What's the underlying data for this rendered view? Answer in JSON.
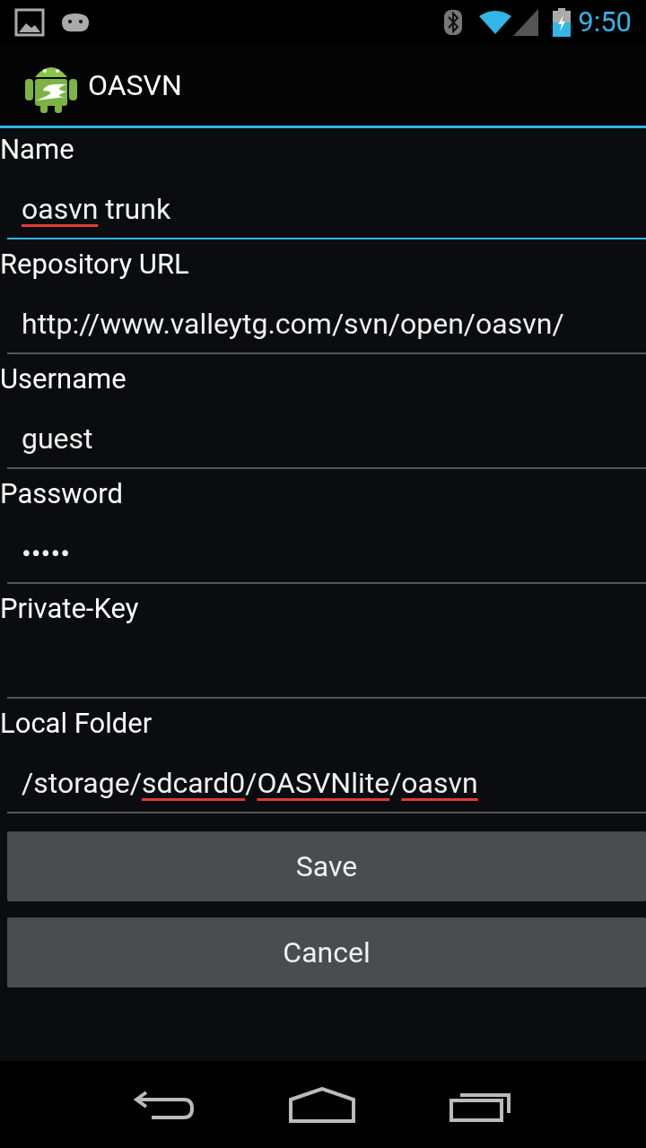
{
  "status_bar": {
    "time": "9:50"
  },
  "app_bar": {
    "title": "OASVN"
  },
  "fields": [
    {
      "label": "Name",
      "focused": true,
      "segments": [
        {
          "text": "oasvn",
          "misspelled": true
        },
        {
          "text": " trunk",
          "misspelled": false
        }
      ]
    },
    {
      "label": "Repository URL",
      "focused": false,
      "segments": [
        {
          "text": "http://www.valleytg.com/svn/open/oasvn/",
          "misspelled": false
        }
      ]
    },
    {
      "label": "Username",
      "focused": false,
      "segments": [
        {
          "text": "guest",
          "misspelled": false
        }
      ]
    },
    {
      "label": "Password",
      "focused": false,
      "segments": [
        {
          "text": "•••••",
          "misspelled": false
        }
      ]
    },
    {
      "label": "Private-Key",
      "focused": false
    },
    {
      "label": "Local Folder",
      "focused": false,
      "segments": [
        {
          "text": "/storage/",
          "misspelled": false
        },
        {
          "text": "sdcard0",
          "misspelled": true
        },
        {
          "text": "/",
          "misspelled": false
        },
        {
          "text": "OASVNlite",
          "misspelled": true
        },
        {
          "text": "/",
          "misspelled": false
        },
        {
          "text": "oasvn",
          "misspelled": true
        }
      ]
    }
  ],
  "buttons": [
    "Save",
    "Cancel"
  ]
}
